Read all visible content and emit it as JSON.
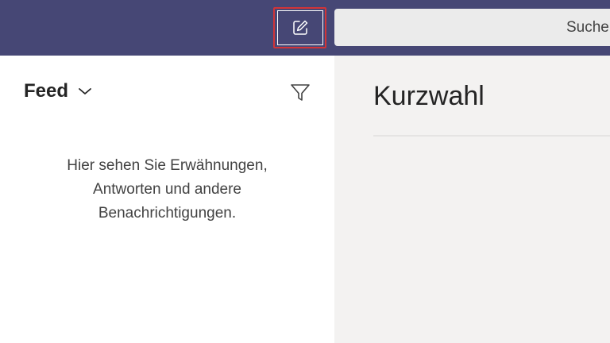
{
  "colors": {
    "topbar": "#464775",
    "highlight": "#d13438",
    "search_bg": "#ebebeb",
    "left_pane": "#ffffff",
    "right_pane": "#f3f2f1"
  },
  "topbar": {
    "compose_icon": "compose-icon",
    "search": {
      "placeholder": "Suche"
    }
  },
  "feed": {
    "title": "Feed",
    "dropdown_icon": "chevron-down-icon",
    "filter_icon": "filter-icon",
    "empty_lines": [
      "Hier sehen Sie Erwähnungen,",
      "Antworten und andere",
      "Benachrichtigungen."
    ]
  },
  "main": {
    "title": "Kurzwahl"
  }
}
